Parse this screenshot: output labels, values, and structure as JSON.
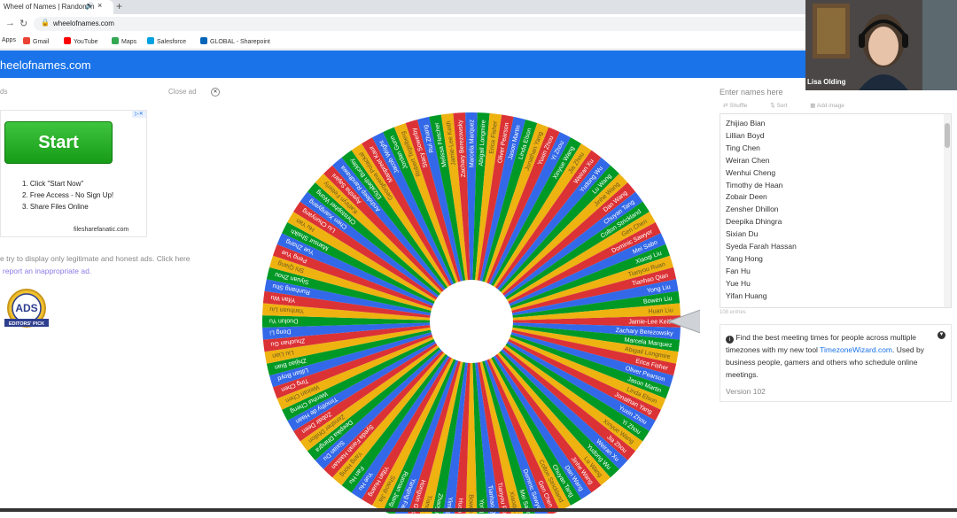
{
  "browser": {
    "tab_title": "Wheel of Names | Random n",
    "url": "wheelofnames.com"
  },
  "bookmarks": [
    {
      "label": "Apps",
      "color": "#4285f4"
    },
    {
      "label": "Gmail",
      "color": "#ea4335"
    },
    {
      "label": "YouTube",
      "color": "#ff0000"
    },
    {
      "label": "Maps",
      "color": "#34a853"
    },
    {
      "label": "Salesforce",
      "color": "#00a1e0"
    },
    {
      "label": "GLOBAL - Sharepoint",
      "color": "#0364b8"
    }
  ],
  "site": {
    "title": "heelofnames.com"
  },
  "left": {
    "ads_label": "ds",
    "close_ad": "Close ad",
    "ad_start": "Start",
    "ad_steps": [
      "1. Click \"Start Now\"",
      "2. Free Access - No Sign Up!",
      "3. Share Files Online"
    ],
    "ad_source": "filesharefanatic.com",
    "legit_text": "e try to display only legitimate and honest ads. Click here",
    "report_link": "report an inappropriate ad.",
    "badge_text": "ADS",
    "badge_sub": "EDITORS' PICK"
  },
  "wheel": {
    "segment_colors": [
      "#db3236",
      "#3369e8",
      "#009925",
      "#eeb211"
    ],
    "segment_count": 108,
    "labels_shown": [
      "Jamie-Lee Keith",
      "Zachary Berezowsky",
      "Marcela Marquez",
      "Abigail Longmire",
      "Erica Fisher",
      "Oliver Pearson",
      "Jason Martin",
      "Linda Elson",
      "Jonathan Yang",
      "Yuxin Zhou",
      "Yi Zhou",
      "Xinyue Wang",
      "Jia Zhou",
      "Weiran Xu",
      "Yudong Wu",
      "Lu Wang",
      "Jinhe Wang",
      "Dan Wang",
      "Chuyan Tang",
      "Colton Strickland",
      "Gen Chen",
      "Dominic Sawyer",
      "Mei Sabo",
      "Xiaoqi Liu",
      "Tianyou Ruan",
      "Tianhao Qian",
      "Yong Liu",
      "Bowen Liu",
      "Huan Liu",
      "Yiming Li",
      "Zhaoyu Li",
      "Tianqi Li",
      "Hongxin Guo",
      "Yanqing Fan",
      "Ruonan Jiang",
      "Shaoqi Jia",
      "Yifan Huang",
      "Yue Hu",
      "Fan Hu",
      "Yang Hong",
      "Syeda Farah Hassan",
      "Sixian Du",
      "Deepika Dhingra",
      "Zensher Dhillon",
      "Zobair Deen",
      "Timothy de Haan",
      "Wenhui Cheng",
      "Weiran Chen",
      "Ting Chen",
      "Lillian Boyd",
      "Zhijiao Bian",
      "Liu Lian",
      "Zhuohan Gu",
      "Dong Li",
      "Duolun Yu",
      "Yanhuan Liu",
      "Yifan Wu",
      "Runhang Shu",
      "Siyuan Zhou",
      "Shi Qiang",
      "Peng Yue",
      "Yue Zhang",
      "Mansur Shaikh",
      "Hu Yan",
      "Liu Chunyang",
      "Chen Xiangyang",
      "Christopher Wong",
      "Kathryn Fetterly",
      "Ayesha Sajani",
      "Arshdeep Randhawa",
      "Elizabeth Buckley",
      "Georgeena Polackal",
      "Manpreet Kaur",
      "Jacob Wright",
      "Jordan Gunn",
      "Robert Tegelberg",
      "Stacy Sowerby",
      "Rui Zhang",
      "Melissa Fletcher"
    ]
  },
  "right": {
    "enter_names": "Enter names here",
    "tools": [
      "Shuffle",
      "Sort",
      "Add image"
    ],
    "names": [
      "Zhijiao Bian",
      "Lillian Boyd",
      "Ting Chen",
      "Weiran Chen",
      "Wenhui Cheng",
      "Timothy de Haan",
      "Zobair Deen",
      "Zensher Dhillon",
      "Deepika Dhingra",
      "Sixian Du",
      "Syeda Farah Hassan",
      "Yang Hong",
      "Fan Hu",
      "Yue Hu",
      "Yifan Huang"
    ],
    "entries": "108 entries",
    "info_pre": "Find the best meeting times for people across multiple timezones with my new tool ",
    "info_link": "TimezoneWizard.com",
    "info_post": ". Used by business people, gamers and others who schedule online meetings.",
    "version": "Version 102"
  },
  "webcam": {
    "name": "Lisa Olding"
  }
}
